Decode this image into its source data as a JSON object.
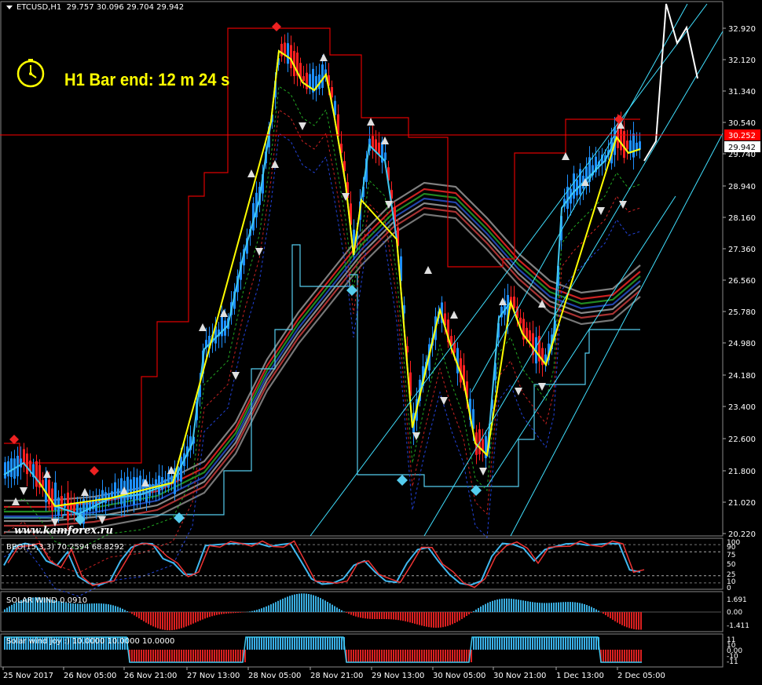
{
  "header": {
    "symbol_timeframe": "ETCUSD,H1",
    "ohlc": "29.757 30.096 29.704 29.942"
  },
  "timer": {
    "text": "H1 Bar end: 12 m 24 s",
    "color": "#ffff00",
    "icon": "clock-icon"
  },
  "watermark": "www.kamforex.ru",
  "price_axis": {
    "ticks": [
      "32.920",
      "32.120",
      "31.340",
      "30.540",
      "29.740",
      "28.940",
      "28.160",
      "27.360",
      "26.560",
      "25.780",
      "24.980",
      "24.180",
      "23.400",
      "22.600",
      "21.800",
      "21.020",
      "20.220"
    ],
    "horizontal_line_label": "30.252",
    "current_price_label": "29.942"
  },
  "time_axis": {
    "labels": [
      "25 Nov 2017",
      "26 Nov 05:00",
      "26 Nov 21:00",
      "27 Nov 13:00",
      "28 Nov 05:00",
      "28 Nov 21:00",
      "29 Nov 13:00",
      "30 Nov 05:00",
      "30 Nov 21:00",
      "1 Dec 13:00",
      "2 Dec 05:00"
    ]
  },
  "sub1": {
    "label": "BBO(15,3,3) 70.2594 68.8292",
    "ticks": [
      "100",
      "90",
      "75",
      "50",
      "25",
      "10",
      "0"
    ]
  },
  "sub2": {
    "label": "SOLAR WIND 0.0910",
    "ticks": [
      "1.691",
      "0.00",
      "-1.411"
    ]
  },
  "sub3": {
    "label": "Solar wind joy :) 10.0000 10.0000 10.0000",
    "ticks": [
      "11",
      "10",
      "0.00",
      "-10",
      "-11"
    ]
  },
  "colors": {
    "bull_candle": "#1e90ff",
    "bear_candle": "#ff2020",
    "price_line": "#ff0000",
    "channel_upper": "#dd0000",
    "channel_lower": "#55ccee",
    "trend_lines": "#40e0ff",
    "forecast": "#ffffff",
    "solar_pos": "#3aaee0",
    "solar_neg": "#dd2020"
  }
}
